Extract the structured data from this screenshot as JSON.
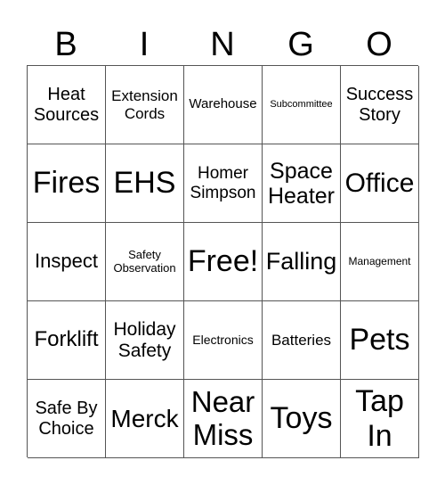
{
  "header": [
    "B",
    "I",
    "N",
    "G",
    "O"
  ],
  "cells": [
    [
      "Heat Sources",
      "Extension Cords",
      "Warehouse",
      "Subcommittee",
      "Success Story"
    ],
    [
      "Fires",
      "EHS",
      "Homer Simpson",
      "Space Heater",
      "Office"
    ],
    [
      "Inspect",
      "Safety Observation",
      "Free!",
      "Falling",
      "Management"
    ],
    [
      "Forklift",
      "Holiday Safety",
      "Electronics",
      "Batteries",
      "Pets"
    ],
    [
      "Safe By Choice",
      "Merck",
      "Near Miss",
      "Toys",
      "Tap In"
    ]
  ]
}
